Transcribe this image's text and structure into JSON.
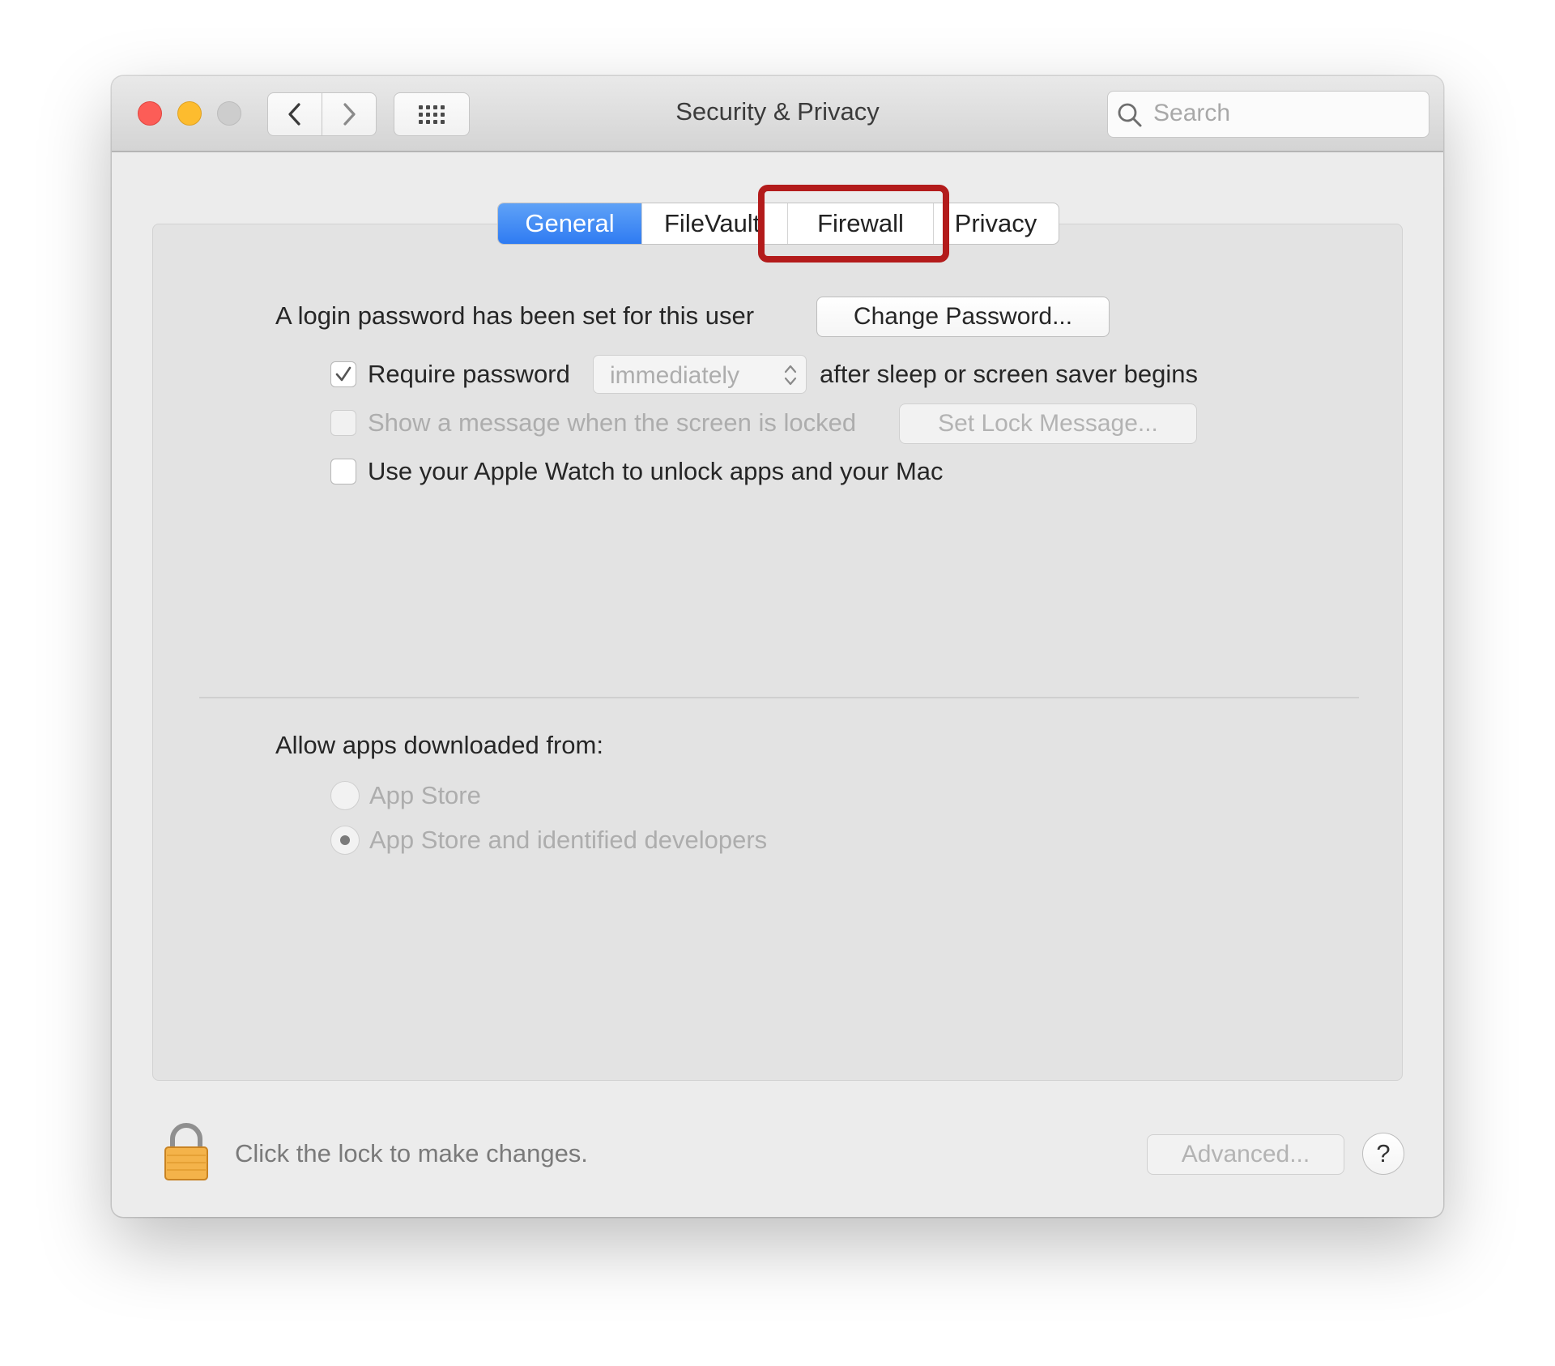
{
  "window": {
    "title": "Security & Privacy"
  },
  "search": {
    "placeholder": "Search"
  },
  "tabs": [
    {
      "label": "General",
      "selected": true
    },
    {
      "label": "FileVault",
      "selected": false
    },
    {
      "label": "Firewall",
      "selected": false
    },
    {
      "label": "Privacy",
      "selected": false
    }
  ],
  "general": {
    "login_password_text": "A login password has been set for this user",
    "change_password_label": "Change Password...",
    "require_password": {
      "label": "Require password",
      "checked": true,
      "interval_value": "immediately",
      "suffix": "after sleep or screen saver begins"
    },
    "show_message": {
      "label": "Show a message when the screen is locked",
      "checked": false,
      "button_label": "Set Lock Message..."
    },
    "apple_watch": {
      "label": "Use your Apple Watch to unlock apps and your Mac",
      "checked": false
    },
    "allow_apps": {
      "heading": "Allow apps downloaded from:",
      "options": [
        {
          "label": "App Store",
          "selected": false
        },
        {
          "label": "App Store and identified developers",
          "selected": true
        }
      ]
    }
  },
  "footer": {
    "lock_text": "Click the lock to make changes.",
    "advanced_label": "Advanced...",
    "help_label": "?"
  },
  "colors": {
    "accent": "#2f7bf2",
    "highlight_box": "#b31b1b",
    "close": "#fc5d57",
    "minimize": "#fdbc2e",
    "zoom_disabled": "#cdcdcd"
  }
}
